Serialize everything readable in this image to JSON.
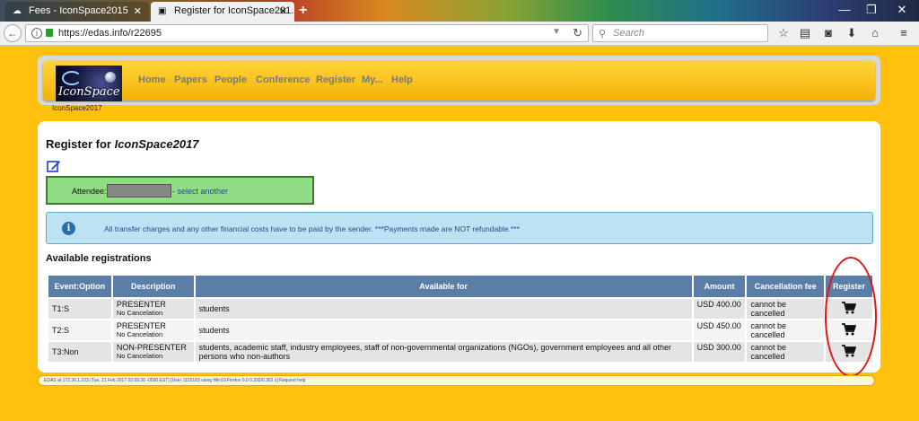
{
  "browser": {
    "tabs": [
      {
        "label": "Fees - IconSpace2015",
        "active": false
      },
      {
        "label": "Register for IconSpace201...",
        "active": true
      }
    ],
    "url": "https://edas.info/r22695",
    "search_placeholder": "Search",
    "icons": [
      "back-icon",
      "info-icon",
      "lock-icon",
      "dropdown-icon",
      "reload-icon",
      "search-icon",
      "star-icon",
      "reading-list-icon",
      "pocket-icon",
      "download-icon",
      "home-icon",
      "menu-icon"
    ]
  },
  "site": {
    "logo_text": "IconSpace",
    "logo_caption": "IconSpace2017",
    "menu": [
      "Home",
      "Papers",
      "People",
      "Conference",
      "Register",
      "My...",
      "Help"
    ]
  },
  "page": {
    "title_prefix": "Register for ",
    "title_conf": "IconSpace2017",
    "attendee_label": "Attendee:",
    "attendee_link": "- select another",
    "notice": "All transfer charges and any other financial costs have to be paid by the sender. ***Payments made are NOT refundable.***",
    "section": "Available registrations"
  },
  "table": {
    "headers": [
      "Event:Option",
      "Description",
      "Available for",
      "Amount",
      "Cancellation fee",
      "Register"
    ],
    "rows": [
      {
        "event": "T1:S",
        "desc": "PRESENTER",
        "desc_sub": "No Cancelation",
        "available": "students",
        "amount": "USD 400.00",
        "cancel": "cannot be cancelled"
      },
      {
        "event": "T2:S",
        "desc": "PRESENTER",
        "desc_sub": "No Cancelation",
        "available": "students",
        "amount": "USD 450.00",
        "cancel": "cannot be cancelled"
      },
      {
        "event": "T3:Non",
        "desc": "NON-PRESENTER",
        "desc_sub": "No Cancelation",
        "available": "students, academic staff, industry employees, staff of non-governmental organizations (NGOs), government employees and all other persons who non-authors",
        "amount": "USD 300.00",
        "cancel": "cannot be cancelled"
      }
    ]
  },
  "footer": "EDAS at 172.30.1.223 (Tue, 21 Feb 2017 02:09:26 -0500 EST) [User 1152183 using Win10:Firefox 0.0 0.292/0.352 s] Request help",
  "colors": {
    "page_bg": "#ffc10d",
    "table_header": "#5b7ea8",
    "attendee_bg": "#90dd84",
    "notice_bg": "#bde2f3",
    "annotation": "#e21515"
  }
}
